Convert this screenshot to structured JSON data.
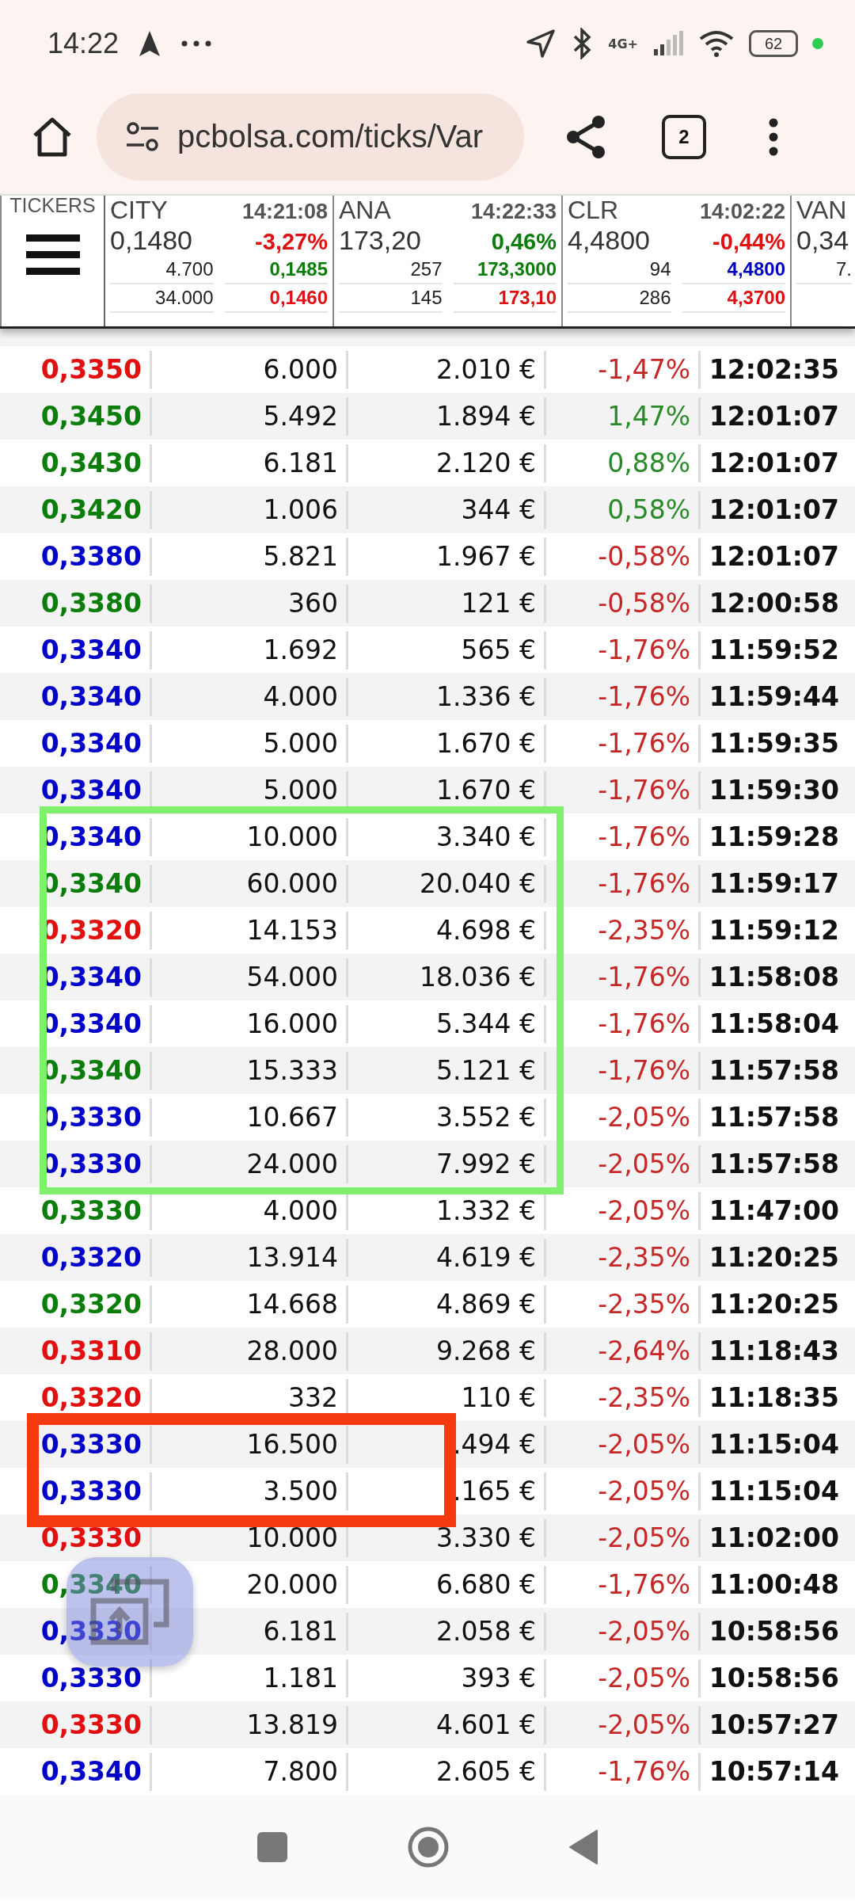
{
  "status_bar": {
    "time": "14:22",
    "network": "4G+",
    "battery": "62"
  },
  "browser": {
    "url": "pcbolsa.com/ticks/Var",
    "tab_count": "2"
  },
  "tickers": {
    "label": "TICKERS",
    "items": [
      {
        "name": "CITY",
        "time": "14:21:08",
        "price": "0,1480",
        "change": {
          "text": "-3,27%",
          "color": "#dd1111"
        },
        "quotes": [
          {
            "volume": "4.700",
            "price": "0,1485",
            "color": "#0b7d0b"
          },
          {
            "volume": "34.000",
            "price": "0,1460",
            "color": "#dd1111"
          }
        ]
      },
      {
        "name": "ANA",
        "time": "14:22:33",
        "price": "173,20",
        "change": {
          "text": "0,46%",
          "color": "#0b7d0b"
        },
        "quotes": [
          {
            "volume": "257",
            "price": "173,3000",
            "color": "#0b7d0b"
          },
          {
            "volume": "145",
            "price": "173,10",
            "color": "#dd1111"
          }
        ]
      },
      {
        "name": "CLR",
        "time": "14:02:22",
        "price": "4,4800",
        "change": {
          "text": "-0,44%",
          "color": "#dd1111"
        },
        "quotes": [
          {
            "volume": "94",
            "price": "4,4800",
            "color": "#0000c0"
          },
          {
            "volume": "286",
            "price": "4,3700",
            "color": "#dd1111"
          }
        ]
      },
      {
        "name": "VAN",
        "price": "0,34",
        "quotes": [
          {
            "volume": "7."
          }
        ]
      }
    ]
  },
  "trades": [
    {
      "price": "0,3350",
      "color": "#e01010",
      "quantity": "6.000",
      "amount": "2.010 €",
      "change": {
        "text": "-1,47%",
        "color": "#c62828"
      },
      "time": "12:02:35"
    },
    {
      "price": "0,3450",
      "color": "#0b7d0b",
      "quantity": "5.492",
      "amount": "1.894 €",
      "change": {
        "text": "1,47%",
        "color": "#2a8a2a"
      },
      "time": "12:01:07"
    },
    {
      "price": "0,3430",
      "color": "#0b7d0b",
      "quantity": "6.181",
      "amount": "2.120 €",
      "change": {
        "text": "0,88%",
        "color": "#2a8a2a"
      },
      "time": "12:01:07"
    },
    {
      "price": "0,3420",
      "color": "#0b7d0b",
      "quantity": "1.006",
      "amount": "344 €",
      "change": {
        "text": "0,58%",
        "color": "#2a8a2a"
      },
      "time": "12:01:07"
    },
    {
      "price": "0,3380",
      "color": "#0000c8",
      "quantity": "5.821",
      "amount": "1.967 €",
      "change": {
        "text": "-0,58%",
        "color": "#c62828"
      },
      "time": "12:01:07"
    },
    {
      "price": "0,3380",
      "color": "#0b7d0b",
      "quantity": "360",
      "amount": "121 €",
      "change": {
        "text": "-0,58%",
        "color": "#c62828"
      },
      "time": "12:00:58"
    },
    {
      "price": "0,3340",
      "color": "#0000c8",
      "quantity": "1.692",
      "amount": "565 €",
      "change": {
        "text": "-1,76%",
        "color": "#c62828"
      },
      "time": "11:59:52"
    },
    {
      "price": "0,3340",
      "color": "#0000c8",
      "quantity": "4.000",
      "amount": "1.336 €",
      "change": {
        "text": "-1,76%",
        "color": "#c62828"
      },
      "time": "11:59:44"
    },
    {
      "price": "0,3340",
      "color": "#0000c8",
      "quantity": "5.000",
      "amount": "1.670 €",
      "change": {
        "text": "-1,76%",
        "color": "#c62828"
      },
      "time": "11:59:35"
    },
    {
      "price": "0,3340",
      "color": "#0000c8",
      "quantity": "5.000",
      "amount": "1.670 €",
      "change": {
        "text": "-1,76%",
        "color": "#c62828"
      },
      "time": "11:59:30"
    },
    {
      "price": "0,3340",
      "color": "#0000c8",
      "quantity": "10.000",
      "amount": "3.340 €",
      "change": {
        "text": "-1,76%",
        "color": "#c62828"
      },
      "time": "11:59:28"
    },
    {
      "price": "0,3340",
      "color": "#0b7d0b",
      "quantity": "60.000",
      "amount": "20.040 €",
      "change": {
        "text": "-1,76%",
        "color": "#c62828"
      },
      "time": "11:59:17"
    },
    {
      "price": "0,3320",
      "color": "#e01010",
      "quantity": "14.153",
      "amount": "4.698 €",
      "change": {
        "text": "-2,35%",
        "color": "#c62828"
      },
      "time": "11:59:12"
    },
    {
      "price": "0,3340",
      "color": "#0000c8",
      "quantity": "54.000",
      "amount": "18.036 €",
      "change": {
        "text": "-1,76%",
        "color": "#c62828"
      },
      "time": "11:58:08"
    },
    {
      "price": "0,3340",
      "color": "#0000c8",
      "quantity": "16.000",
      "amount": "5.344 €",
      "change": {
        "text": "-1,76%",
        "color": "#c62828"
      },
      "time": "11:58:04"
    },
    {
      "price": "0,3340",
      "color": "#0b7d0b",
      "quantity": "15.333",
      "amount": "5.121 €",
      "change": {
        "text": "-1,76%",
        "color": "#c62828"
      },
      "time": "11:57:58"
    },
    {
      "price": "0,3330",
      "color": "#0000c8",
      "quantity": "10.667",
      "amount": "3.552 €",
      "change": {
        "text": "-2,05%",
        "color": "#c62828"
      },
      "time": "11:57:58"
    },
    {
      "price": "0,3330",
      "color": "#0000c8",
      "quantity": "24.000",
      "amount": "7.992 €",
      "change": {
        "text": "-2,05%",
        "color": "#c62828"
      },
      "time": "11:57:58"
    },
    {
      "price": "0,3330",
      "color": "#0b7d0b",
      "quantity": "4.000",
      "amount": "1.332 €",
      "change": {
        "text": "-2,05%",
        "color": "#c62828"
      },
      "time": "11:47:00"
    },
    {
      "price": "0,3320",
      "color": "#0000c8",
      "quantity": "13.914",
      "amount": "4.619 €",
      "change": {
        "text": "-2,35%",
        "color": "#c62828"
      },
      "time": "11:20:25"
    },
    {
      "price": "0,3320",
      "color": "#0b7d0b",
      "quantity": "14.668",
      "amount": "4.869 €",
      "change": {
        "text": "-2,35%",
        "color": "#c62828"
      },
      "time": "11:20:25"
    },
    {
      "price": "0,3310",
      "color": "#e01010",
      "quantity": "28.000",
      "amount": "9.268 €",
      "change": {
        "text": "-2,64%",
        "color": "#c62828"
      },
      "time": "11:18:43"
    },
    {
      "price": "0,3320",
      "color": "#e01010",
      "quantity": "332",
      "amount": "110 €",
      "change": {
        "text": "-2,35%",
        "color": "#c62828"
      },
      "time": "11:18:35"
    },
    {
      "price": "0,3330",
      "color": "#0000c8",
      "quantity": "16.500",
      "amount": ".494 €",
      "change": {
        "text": "-2,05%",
        "color": "#c62828"
      },
      "time": "11:15:04"
    },
    {
      "price": "0,3330",
      "color": "#0000c8",
      "quantity": "3.500",
      "amount": ".165 €",
      "change": {
        "text": "-2,05%",
        "color": "#c62828"
      },
      "time": "11:15:04"
    },
    {
      "price": "0,3330",
      "color": "#e01010",
      "quantity": "10.000",
      "amount": "3.330 €",
      "change": {
        "text": "-2,05%",
        "color": "#c62828"
      },
      "time": "11:02:00"
    },
    {
      "price": "0,3340",
      "color": "#0b7d0b",
      "quantity": "20.000",
      "amount": "6.680 €",
      "change": {
        "text": "-1,76%",
        "color": "#c62828"
      },
      "time": "11:00:48"
    },
    {
      "price": "0,3330",
      "color": "#0000c8",
      "quantity": "6.181",
      "amount": "2.058 €",
      "change": {
        "text": "-2,05%",
        "color": "#c62828"
      },
      "time": "10:58:56"
    },
    {
      "price": "0,3330",
      "color": "#0000c8",
      "quantity": "1.181",
      "amount": "393 €",
      "change": {
        "text": "-2,05%",
        "color": "#c62828"
      },
      "time": "10:58:56"
    },
    {
      "price": "0,3330",
      "color": "#e01010",
      "quantity": "13.819",
      "amount": "4.601 €",
      "change": {
        "text": "-2,05%",
        "color": "#c62828"
      },
      "time": "10:57:27"
    },
    {
      "price": "0,3340",
      "color": "#0000c8",
      "quantity": "7.800",
      "amount": "2.605 €",
      "change": {
        "text": "-1,76%",
        "color": "#c62828"
      },
      "time": "10:57:14"
    }
  ],
  "annotations": [
    {
      "color": "#80f06c"
    },
    {
      "color": "#f53a12"
    }
  ]
}
